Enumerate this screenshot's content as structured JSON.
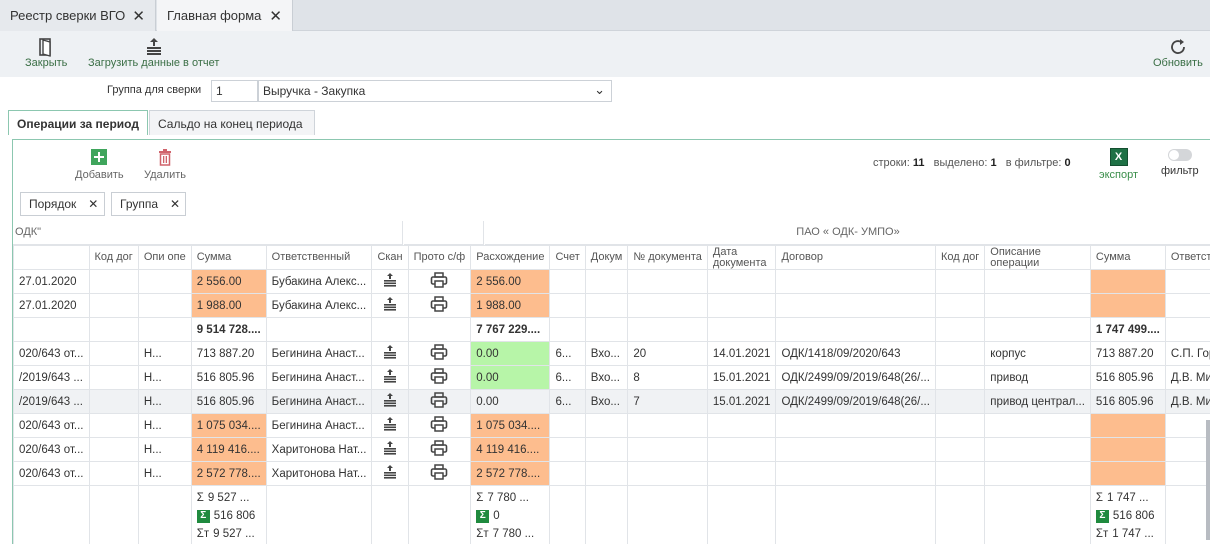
{
  "tabs": [
    {
      "label": "Реестр сверки ВГО"
    },
    {
      "label": "Главная форма"
    }
  ],
  "toolbar": {
    "close_label": "Закрыть",
    "load_label": "Загрузить данные в отчет",
    "refresh_label": "Обновить"
  },
  "group": {
    "label": "Группа для сверки",
    "number": "1",
    "value": "Выручка - Закупка"
  },
  "panel_tabs": [
    {
      "label": "Операции за период",
      "active": true
    },
    {
      "label": "Сальдо на конец периода",
      "active": false
    }
  ],
  "grid_toolbar": {
    "add_label": "Добавить",
    "delete_label": "Удалить",
    "rows_label": "строки:",
    "rows_count": "11",
    "selected_label": "выделено:",
    "selected_count": "1",
    "filtered_label": "в фильтре:",
    "filtered_count": "0",
    "export_label": "экспорт",
    "filter_label": "фильтр"
  },
  "chips": [
    {
      "label": "Порядок"
    },
    {
      "label": "Группа"
    }
  ],
  "group_headers": {
    "left": "ОДК\"",
    "right": "ПАО « ОДК- УМПО»"
  },
  "columns": [
    "",
    "Код дог",
    "Опи опе",
    "Сумма",
    "Ответственный",
    "Скан",
    "Прото с/ф",
    "Расхождение",
    "Счет",
    "Докум",
    "№ документа",
    "Дата документа",
    "Договор",
    "Код дог",
    "Описание операции",
    "Сумма",
    "Ответственный"
  ],
  "rows": [
    {
      "c0": "27.01.2020",
      "c2": "",
      "c3": "2 556.00",
      "c4": "Бубакина Алекс...",
      "c7": "2 556.00",
      "c8": "",
      "c9": "",
      "c10": "",
      "c11": "",
      "c12": "",
      "c14": "",
      "c15": "",
      "c16": ""
    },
    {
      "c0": "27.01.2020",
      "c2": "",
      "c3": "1 988.00",
      "c4": "Бубакина Алекс...",
      "c7": "1 988.00",
      "c8": "",
      "c9": "",
      "c10": "",
      "c11": "",
      "c12": "",
      "c14": "",
      "c15": "",
      "c16": ""
    },
    {
      "c0": "",
      "c2": "",
      "c3": "9 514 728....",
      "c4": "",
      "c7": "7 767 229....",
      "c8": "",
      "c9": "",
      "c10": "",
      "c11": "",
      "c12": "",
      "c14": "",
      "c15": "1 747 499....",
      "c16": ""
    },
    {
      "c0": "020/643 от...",
      "c2": "Н...",
      "c3": "713 887.20",
      "c4": "Бегинина Анаст...",
      "c7": "0.00",
      "c8": "6...",
      "c9": "Вхо...",
      "c10": "20",
      "c11": "14.01.2021",
      "c12": "ОДК/1418/09/2020/643",
      "c14": "корпус",
      "c15": "713 887.20",
      "c16": "С.П. Горшенин"
    },
    {
      "c0": "/2019/643 ...",
      "c2": "Н...",
      "c3": "516 805.96",
      "c4": "Бегинина Анаст...",
      "c7": "0.00",
      "c8": "6...",
      "c9": "Вхо...",
      "c10": "8",
      "c11": "15.01.2021",
      "c12": "ОДК/2499/09/2019/648(26/...",
      "c14": "привод",
      "c15": "516 805.96",
      "c16": "Д.В. Миналтди"
    },
    {
      "c0": "/2019/643 ...",
      "c2": "Н...",
      "c3": "516 805.96",
      "c4": "Бегинина Анаст...",
      "c7": "0.00",
      "c8": "6...",
      "c9": "Вхо...",
      "c10": "7",
      "c11": "15.01.2021",
      "c12": "ОДК/2499/09/2019/648(26/...",
      "c14": "привод централ...",
      "c15": "516 805.96",
      "c16": "Д.В. Миналтди"
    },
    {
      "c0": "020/643 от...",
      "c2": "Н...",
      "c3": "1 075 034....",
      "c4": "Бегинина Анаст...",
      "c7": "1 075 034....",
      "c8": "",
      "c9": "",
      "c10": "",
      "c11": "",
      "c12": "",
      "c14": "",
      "c15": "",
      "c16": ""
    },
    {
      "c0": "020/643 от...",
      "c2": "Н...",
      "c3": "4 119 416....",
      "c4": "Харитонова Нат...",
      "c7": "4 119 416....",
      "c8": "",
      "c9": "",
      "c10": "",
      "c11": "",
      "c12": "",
      "c14": "",
      "c15": "",
      "c16": ""
    },
    {
      "c0": "020/643 от...",
      "c2": "Н...",
      "c3": "2 572 778....",
      "c4": "Харитонова Нат...",
      "c7": "2 572 778....",
      "c8": "",
      "c9": "",
      "c10": "",
      "c11": "",
      "c12": "",
      "c14": "",
      "c15": "",
      "c16": ""
    }
  ],
  "footer": {
    "sum_a": "9 527 ...",
    "sum_a2": "516 806",
    "sum_a3": "9 527 ...",
    "sum_b": "7 780 ...",
    "sum_b2": "0",
    "sum_b3": "7 780 ...",
    "sum_c": "1 747 ...",
    "sum_c2": "516 806",
    "sum_c3": "1 747 ..."
  },
  "colors": {
    "accent": "#3a8e4a",
    "mismatch": "#fdbd8e",
    "match": "#b7f5a8"
  }
}
